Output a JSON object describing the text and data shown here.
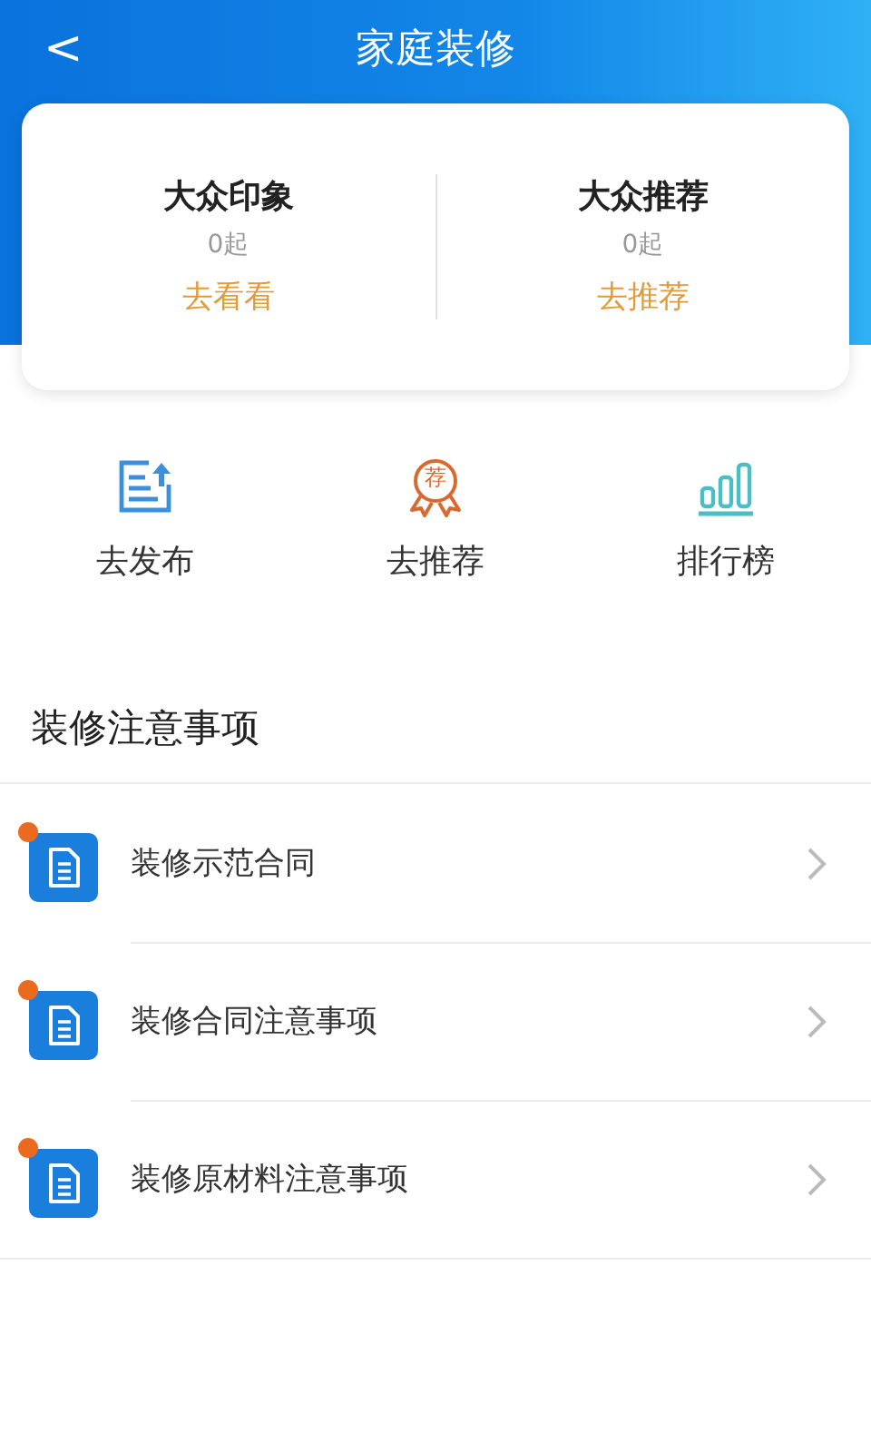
{
  "header": {
    "back": "<",
    "title": "家庭装修"
  },
  "summary": [
    {
      "title": "大众印象",
      "count": "0起",
      "action": "去看看"
    },
    {
      "title": "大众推荐",
      "count": "0起",
      "action": "去推荐"
    }
  ],
  "shortcuts": [
    {
      "kind": "publish",
      "label": "去发布"
    },
    {
      "kind": "recommend",
      "label": "去推荐",
      "icon_text": "荐"
    },
    {
      "kind": "ranking",
      "label": "排行榜"
    }
  ],
  "section": {
    "title": "装修注意事项"
  },
  "notices": [
    {
      "title": "装修示范合同",
      "unread": true
    },
    {
      "title": "装修合同注意事项",
      "unread": true
    },
    {
      "title": "装修原材料注意事项",
      "unread": true
    }
  ]
}
